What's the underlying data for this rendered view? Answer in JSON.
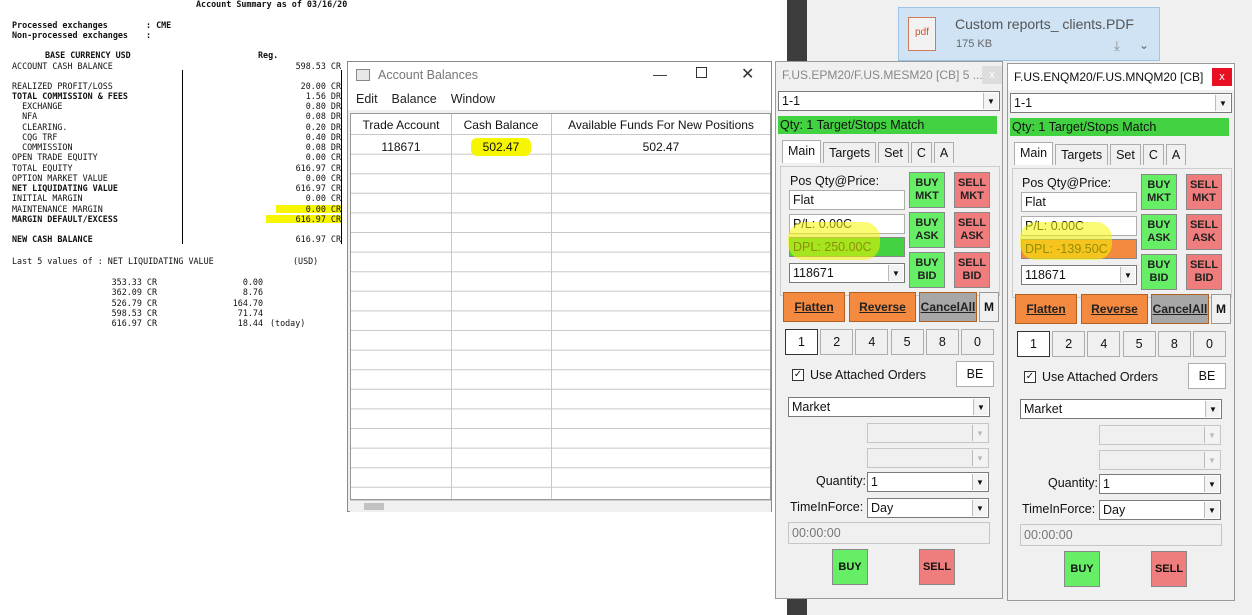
{
  "report": {
    "header": "Account Summary as of 03/16/20",
    "processed_label": "Processed exchanges",
    "processed_value": ": CME",
    "nonprocessed_label": "Non-processed exchanges",
    "nonprocessed_value": ":",
    "base_currency": "BASE CURRENCY USD",
    "reg": "Reg.",
    "lines": [
      {
        "label": "ACCOUNT CASH BALANCE",
        "value": "598.53 CR",
        "bold": false
      },
      {
        "label": "REALIZED PROFIT/LOSS",
        "value": "20.00 CR",
        "bold": false
      },
      {
        "label": "TOTAL COMMISSION & FEES",
        "value": "1.56 DR",
        "bold": true
      },
      {
        "label": "  EXCHANGE",
        "value": "0.80 DR",
        "bold": false
      },
      {
        "label": "  NFA",
        "value": "0.08 DR",
        "bold": false
      },
      {
        "label": "  CLEARING.",
        "value": "0.20 DR",
        "bold": false
      },
      {
        "label": "  CQG TRF",
        "value": "0.40 DR",
        "bold": false
      },
      {
        "label": "  COMMISSION",
        "value": "0.08 DR",
        "bold": false
      },
      {
        "label": "OPEN TRADE EQUITY",
        "value": "0.00 CR",
        "bold": false
      },
      {
        "label": "TOTAL EQUITY",
        "value": "616.97 CR",
        "bold": false
      },
      {
        "label": "OPTION MARKET VALUE",
        "value": "0.00 CR",
        "bold": false
      },
      {
        "label": "NET LIQUIDATING VALUE",
        "value": "616.97 CR",
        "bold": true
      },
      {
        "label": "INITIAL MARGIN",
        "value": "0.00 CR",
        "bold": false
      },
      {
        "label": "MAINTENANCE MARGIN",
        "value": "0.00 CR",
        "bold": false
      },
      {
        "label": "MARGIN DEFAULT/EXCESS",
        "value": "616.97 CR",
        "bold": true
      },
      {
        "label": "NEW CASH BALANCE",
        "value": "616.97 CR",
        "bold": true
      }
    ],
    "last5_label": "Last 5 values of : NET LIQUIDATING VALUE",
    "last5_currency": "(USD)",
    "last5": [
      {
        "value": "353.33 CR",
        "change": "0.00",
        "note": ""
      },
      {
        "value": "362.09 CR",
        "change": "8.76",
        "note": ""
      },
      {
        "value": "526.79 CR",
        "change": "164.70",
        "note": ""
      },
      {
        "value": "598.53 CR",
        "change": "71.74",
        "note": ""
      },
      {
        "value": "616.97 CR",
        "change": "18.44",
        "note": "(today)"
      }
    ]
  },
  "download": {
    "filename": "Custom reports_ clients.PDF",
    "size": "175 KB",
    "icon_label": "pdf"
  },
  "account_balances": {
    "title": "Account Balances",
    "menu": [
      "Edit",
      "Balance",
      "Window"
    ],
    "columns": [
      "Trade Account",
      "Cash Balance",
      "Available Funds For New Positions"
    ],
    "rows": [
      [
        "118671",
        "502.47",
        "502.47"
      ]
    ]
  },
  "trade_windows": [
    {
      "title": "F.US.EPM20/F.US.MESM20 [CB]  5 ...",
      "account_combo": "1-1",
      "status": "Qty: 1 Target/Stops Match",
      "tabs": [
        "Main",
        "Targets",
        "Set",
        "C",
        "A"
      ],
      "pos_label": "Pos Qty@Price:",
      "pos_value": "Flat",
      "pl": "P/L: 0.00C",
      "dpl": "DPL: 250.00C",
      "dpl_color": "#41d141",
      "account": "118671",
      "buy_mkt": "BUY MKT",
      "sell_mkt": "SELL MKT",
      "buy_ask": "BUY ASK",
      "sell_ask": "SELL ASK",
      "buy_bid": "BUY BID",
      "sell_bid": "SELL BID",
      "flatten": "Flatten",
      "reverse": "Reverse",
      "cancel_all": "CancelAll",
      "m": "M",
      "qty_buttons": [
        "1",
        "2",
        "4",
        "5",
        "8",
        "0"
      ],
      "use_attached": "Use Attached Orders",
      "use_attached_checked": "✓",
      "be": "BE",
      "order_type": "Market",
      "quantity_label": "Quantity:",
      "quantity": "1",
      "tif_label": "TimeInForce:",
      "tif": "Day",
      "time": "00:00:00",
      "buy": "BUY",
      "sell": "SELL",
      "close": "x"
    },
    {
      "title": "F.US.ENQM20/F.US.MNQM20 [CB]",
      "account_combo": "1-1",
      "status": "Qty: 1 Target/Stops Match",
      "tabs": [
        "Main",
        "Targets",
        "Set",
        "C",
        "A"
      ],
      "pos_label": "Pos Qty@Price:",
      "pos_value": "Flat",
      "pl": "P/L: 0.00C",
      "dpl": "DPL: -139.50C",
      "dpl_color": "#f48a40",
      "account": "118671",
      "buy_mkt": "BUY MKT",
      "sell_mkt": "SELL MKT",
      "buy_ask": "BUY ASK",
      "sell_ask": "SELL ASK",
      "buy_bid": "BUY BID",
      "sell_bid": "SELL BID",
      "flatten": "Flatten",
      "reverse": "Reverse",
      "cancel_all": "CancelAll",
      "m": "M",
      "qty_buttons": [
        "1",
        "2",
        "4",
        "5",
        "8",
        "0"
      ],
      "use_attached": "Use Attached Orders",
      "use_attached_checked": "✓",
      "be": "BE",
      "order_type": "Market",
      "quantity_label": "Quantity:",
      "quantity": "1",
      "tif_label": "TimeInForce:",
      "tif": "Day",
      "time": "00:00:00",
      "buy": "BUY",
      "sell": "SELL",
      "close": "x"
    }
  ]
}
